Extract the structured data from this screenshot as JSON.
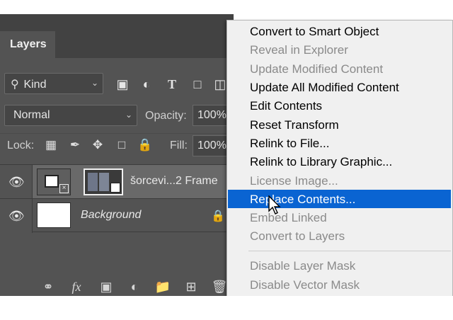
{
  "panel": {
    "tab_label": "Layers",
    "filter": {
      "kind_label": "Kind",
      "icons": [
        "image-filter-icon",
        "adjustment-filter-icon",
        "type-filter-icon",
        "shape-filter-icon",
        "smart-object-filter-icon"
      ]
    },
    "blend_mode": "Normal",
    "opacity_label": "Opacity:",
    "opacity_value": "100%",
    "lock_label": "Lock:",
    "fill_label": "Fill:",
    "fill_value": "100%",
    "layers": [
      {
        "name": "šorcevi...2 Frame",
        "selected": true
      },
      {
        "name": "Background",
        "locked": true
      }
    ],
    "footer_icons": [
      "link-icon",
      "fx-icon",
      "mask-icon",
      "adjustment-icon",
      "folder-icon",
      "new-layer-icon",
      "trash-icon"
    ],
    "footer_fx": "fx"
  },
  "menu": {
    "items": [
      {
        "label": "Convert to Smart Object",
        "enabled": true
      },
      {
        "label": "Reveal in Explorer",
        "enabled": false
      },
      {
        "label": "Update Modified Content",
        "enabled": false
      },
      {
        "label": "Update All Modified Content",
        "enabled": true
      },
      {
        "label": "Edit Contents",
        "enabled": true
      },
      {
        "label": "Reset Transform",
        "enabled": true
      },
      {
        "label": "Relink to File...",
        "enabled": true
      },
      {
        "label": "Relink to Library Graphic...",
        "enabled": true
      },
      {
        "label": "License Image...",
        "enabled": false
      },
      {
        "label": "Replace Contents...",
        "enabled": true,
        "highlighted": true
      },
      {
        "label": "Embed Linked",
        "enabled": false
      },
      {
        "label": "Convert to Layers",
        "enabled": false
      },
      {
        "label": "Disable Layer Mask",
        "enabled": false
      },
      {
        "label": "Disable Vector Mask",
        "enabled": false
      }
    ]
  },
  "colors": {
    "panel_bg": "#535353",
    "selected_layer": "#696969",
    "menu_bg": "#f0f0f0",
    "highlight": "#0a64d2",
    "disabled_text": "#8a8a8a"
  }
}
